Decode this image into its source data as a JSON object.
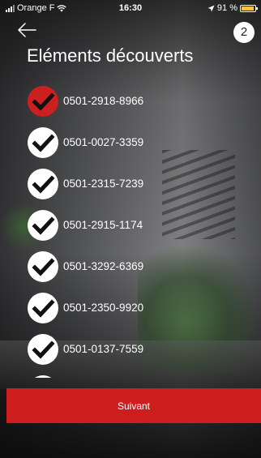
{
  "status_bar": {
    "carrier": "Orange F",
    "time": "16:30",
    "battery_percent": "91 %",
    "battery_level": 0.91,
    "battery_color": "#f5c242"
  },
  "header": {
    "back_icon": "arrow-left-icon",
    "badge_count": "2",
    "title": "Eléments découverts"
  },
  "items": [
    {
      "label": "0501-2918-8966",
      "selected": true
    },
    {
      "label": "0501-0027-3359",
      "selected": false
    },
    {
      "label": "0501-2315-7239",
      "selected": false
    },
    {
      "label": "0501-2915-1174",
      "selected": false
    },
    {
      "label": "0501-3292-6369",
      "selected": false
    },
    {
      "label": "0501-2350-9920",
      "selected": false
    },
    {
      "label": "0501-0137-7559",
      "selected": false
    }
  ],
  "footer": {
    "next_label": "Suivant"
  },
  "colors": {
    "accent": "#cd1d1d",
    "selected_check": "#cc1f1f",
    "unselected_check": "#ffffff"
  }
}
